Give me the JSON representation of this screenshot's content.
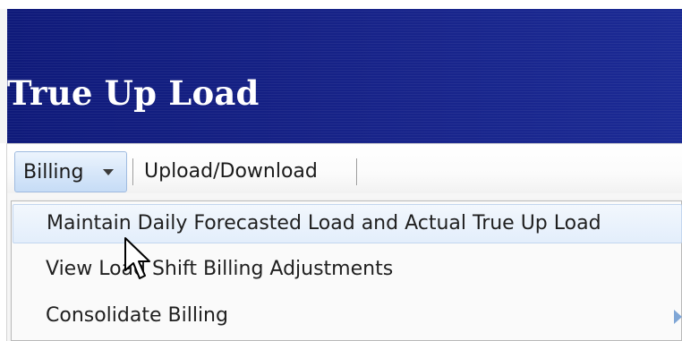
{
  "header": {
    "title": "True Up Load"
  },
  "toolbar": {
    "billing_label": "Billing",
    "upload_label": "Upload/Download"
  },
  "billing_menu": {
    "items": [
      {
        "label": "Maintain Daily Forecasted Load and Actual True Up Load",
        "highlighted": true
      },
      {
        "label": "View Load Shift Billing Adjustments",
        "highlighted": false
      },
      {
        "label": "Consolidate Billing",
        "highlighted": false,
        "has_submenu": true
      }
    ]
  },
  "icons": {
    "billing_dropdown": "caret-down-icon",
    "pointer": "mouse-pointer-icon",
    "submenu": "submenu-arrow-icon"
  },
  "colors": {
    "header_bg": "#172389",
    "header_text": "#ffffff",
    "button_bg": "#d6e6f9",
    "menu_highlight": "#e3eefb"
  }
}
